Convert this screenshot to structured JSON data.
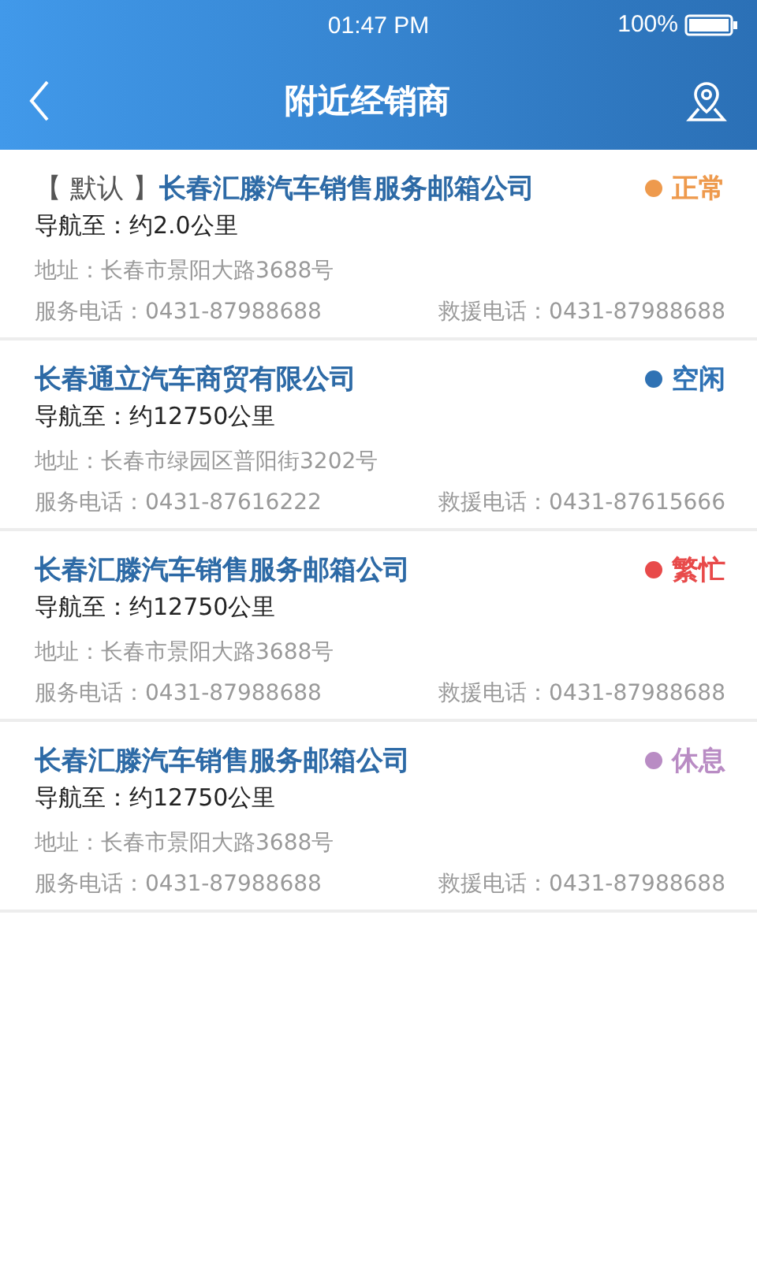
{
  "status_bar": {
    "time": "01:47 PM",
    "battery": "100%"
  },
  "header": {
    "title": "附近经销商"
  },
  "dealers": [
    {
      "prefix": "【 默认 】",
      "name": "长春汇滕汽车销售服务邮箱公司",
      "status": "正常",
      "color": "#ee9a4d",
      "distance": "导航至：约2.0公里",
      "address": "地址：长春市景阳大路3688号",
      "service_phone": "服务电话：0431-87988688",
      "rescue_phone": "救援电话：0431-87988688"
    },
    {
      "name": "长春通立汽车商贸有限公司",
      "status": "空闲",
      "color": "#2f72b4",
      "distance": "导航至：约12750公里",
      "address": "地址：长春市绿园区普阳街3202号",
      "service_phone": "服务电话：0431-87616222",
      "rescue_phone": "救援电话：0431-87615666"
    },
    {
      "name": "长春汇滕汽车销售服务邮箱公司",
      "status": "繁忙",
      "color": "#e84a4a",
      "distance": "导航至：约12750公里",
      "address": "地址：长春市景阳大路3688号",
      "service_phone": "服务电话：0431-87988688",
      "rescue_phone": "救援电话：0431-87988688"
    },
    {
      "name": "长春汇滕汽车销售服务邮箱公司",
      "status": "休息",
      "color": "#b98cc4",
      "distance": "导航至：约12750公里",
      "address": "地址：长春市景阳大路3688号",
      "service_phone": "服务电话：0431-87988688",
      "rescue_phone": "救援电话：0431-87988688"
    }
  ]
}
